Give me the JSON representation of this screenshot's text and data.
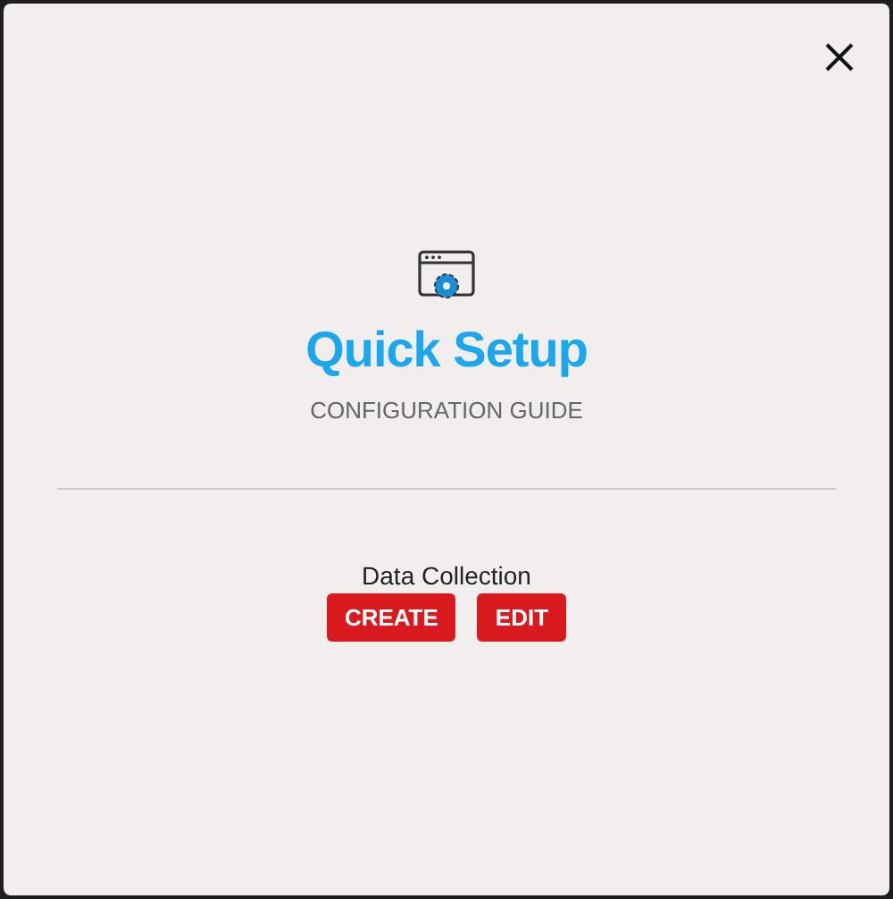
{
  "dialog": {
    "title": "Quick Setup",
    "subtitle": "CONFIGURATION GUIDE"
  },
  "section": {
    "label": "Data Collection",
    "buttons": [
      "CREATE",
      "EDIT"
    ]
  }
}
